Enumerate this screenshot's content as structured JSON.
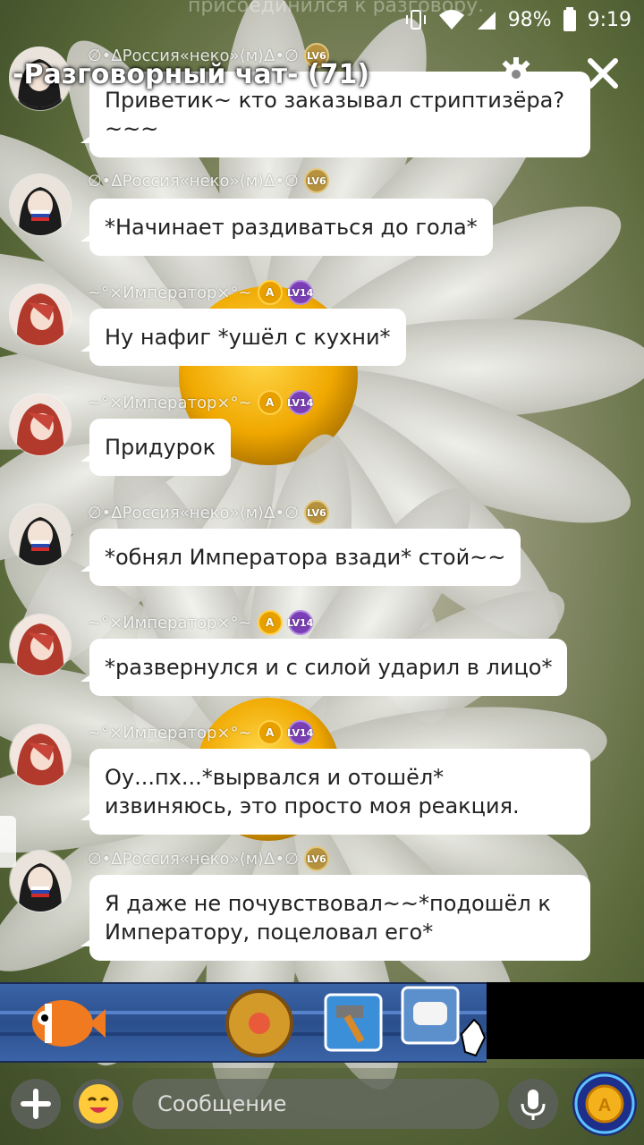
{
  "status_bar": {
    "ghost_text": "присоединился к разговору.",
    "battery": "98%",
    "time": "9:19"
  },
  "header": {
    "title": "-Разговорный чат- (71)"
  },
  "messages": [
    {
      "author": "∅•ΔРоссия«неко»⟨м⟩Δ•∅",
      "level": "LV6",
      "text": "Приветик~ кто заказывал стриптизёра? ~~~"
    },
    {
      "author": "∅•ΔРоссия«неко»⟨м⟩Δ•∅",
      "level": "LV6",
      "text": "*Начинает раздиваться до гола*"
    },
    {
      "author": "~°×Император×°~",
      "level": "LV14",
      "text": "Ну нафиг *ушёл с кухни*"
    },
    {
      "author": "~°×Император×°~",
      "level": "LV14",
      "text": "Придурок"
    },
    {
      "author": "∅•ΔРоссия«неко»⟨м⟩Δ•∅",
      "level": "LV6",
      "text": "*обнял Императора взади* стой~~"
    },
    {
      "author": "~°×Император×°~",
      "level": "LV14",
      "text": "*развернулся и с силой ударил в лицо*"
    },
    {
      "author": "~°×Император×°~",
      "level": "LV14",
      "text": "Оу...пх...*вырвался и отошёл* извиняюсь, это просто моя реакция."
    },
    {
      "author": "∅•ΔРоссия«неко»⟨м⟩Δ•∅",
      "level": "LV6",
      "text": "Я даже не почувствовал~~*подошёл к Императору, поцеловал его*"
    }
  ],
  "input": {
    "placeholder": "Сообщение"
  },
  "colors": {
    "bubble": "#ffffff",
    "banner": "#3a64a8",
    "level6": "#b6923e",
    "level14": "#7a3fb5"
  }
}
